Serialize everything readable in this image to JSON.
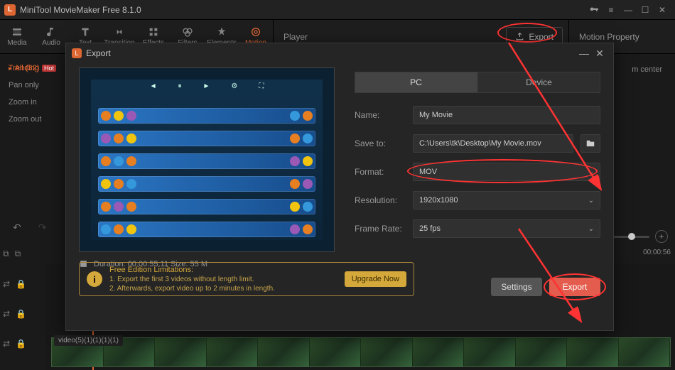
{
  "app": {
    "title": "MiniTool MovieMaker Free 8.1.0"
  },
  "toolbar": {
    "items": [
      {
        "label": "Media"
      },
      {
        "label": "Audio"
      },
      {
        "label": "Text"
      },
      {
        "label": "Transition"
      },
      {
        "label": "Effects"
      },
      {
        "label": "Filters"
      },
      {
        "label": "Elements"
      },
      {
        "label": "Motion"
      }
    ]
  },
  "panels": {
    "player": "Player",
    "export_btn": "Export",
    "property": "Motion Property",
    "property_hint": "m center"
  },
  "sidebar": {
    "all": "All (32)",
    "items": [
      "Trending",
      "Pan only",
      "Zoom in",
      "Zoom out"
    ],
    "hot": "Hot"
  },
  "timeline": {
    "clip_label": "video(5)(1)(1)(1)(1)",
    "time_right": "00:00:56"
  },
  "dialog": {
    "title": "Export",
    "tabs": {
      "pc": "PC",
      "device": "Device"
    },
    "labels": {
      "name": "Name:",
      "saveto": "Save to:",
      "format": "Format:",
      "resolution": "Resolution:",
      "framerate": "Frame Rate:"
    },
    "values": {
      "name": "My Movie",
      "saveto": "C:\\Users\\tk\\Desktop\\My Movie.mov",
      "format": "MOV",
      "resolution": "1920x1080",
      "framerate": "25 fps"
    },
    "info": "Duration:  00:00:55:11  Size:  55 M",
    "limit": {
      "title": "Free Edition Limitations:",
      "l1": "1. Export the first 3 videos without length limit.",
      "l2": "2. Afterwards, export video up to 2 minutes in length.",
      "upgrade": "Upgrade Now"
    },
    "footer": {
      "settings": "Settings",
      "export": "Export"
    }
  }
}
